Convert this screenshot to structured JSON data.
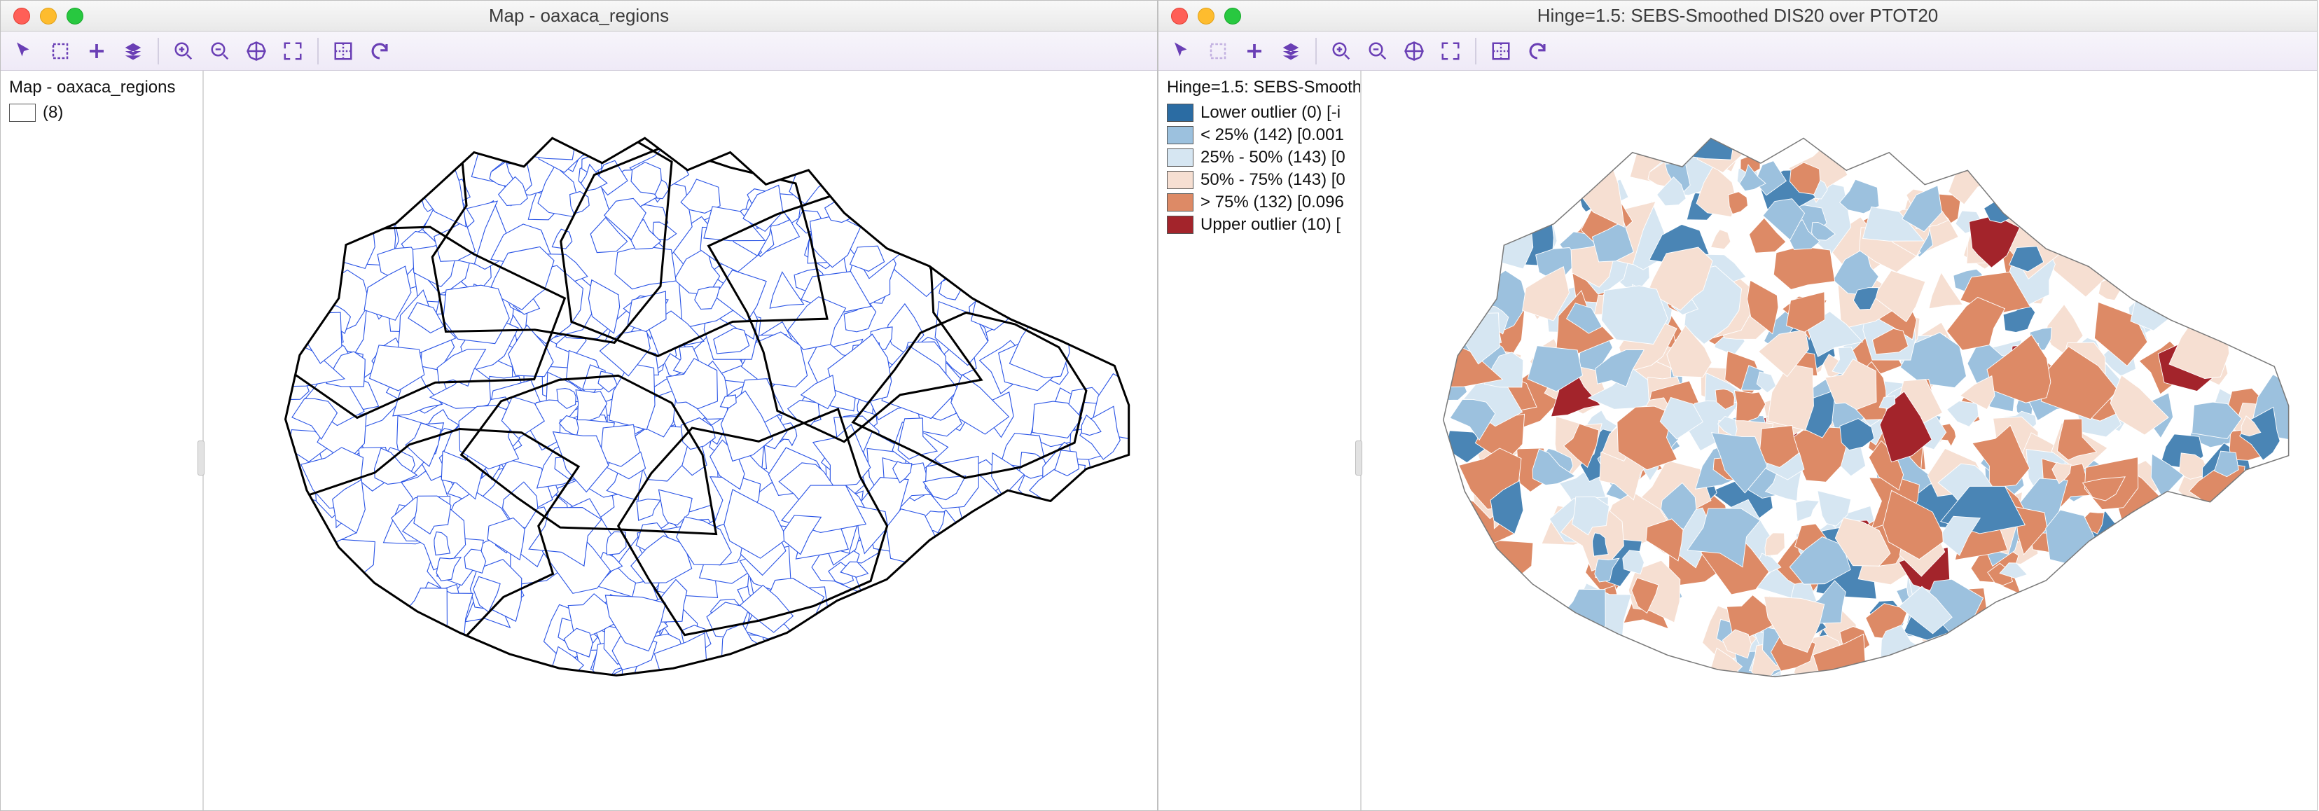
{
  "windows": {
    "left": {
      "title": "Map - oaxaca_regions",
      "legend_title": "Map - oaxaca_regions",
      "legend_items": [
        {
          "fill": "#ffffff",
          "label": "(8)"
        }
      ]
    },
    "right": {
      "title": "Hinge=1.5: SEBS-Smoothed DIS20 over PTOT20",
      "legend_title": "Hinge=1.5: SEBS-Smooth",
      "legend_items": [
        {
          "fill": "#2b6ca3",
          "label": "Lower outlier (0)  [-i"
        },
        {
          "fill": "#9cc1de",
          "label": "< 25% (142)  [0.001"
        },
        {
          "fill": "#d6e6f2",
          "label": "25% - 50% (143)  [0"
        },
        {
          "fill": "#f6dfd2",
          "label": "50% - 75% (143)  [0"
        },
        {
          "fill": "#dd8a66",
          "label": "> 75% (132)  [0.096"
        },
        {
          "fill": "#a3242b",
          "label": "Upper outlier (10)  ["
        }
      ]
    }
  },
  "toolbar_icons": [
    {
      "name": "pointer-icon",
      "disabled": false,
      "svg": "arrow"
    },
    {
      "name": "select-rect-icon",
      "disabled": false,
      "svg": "rect"
    },
    {
      "name": "add-layer-icon",
      "disabled": false,
      "svg": "plus"
    },
    {
      "name": "layers-icon",
      "disabled": false,
      "svg": "layers"
    },
    {
      "name": "sep"
    },
    {
      "name": "zoom-in-icon",
      "disabled": false,
      "svg": "zoomin"
    },
    {
      "name": "zoom-out-icon",
      "disabled": false,
      "svg": "zoomout"
    },
    {
      "name": "pan-icon",
      "disabled": false,
      "svg": "pan"
    },
    {
      "name": "fit-extent-icon",
      "disabled": false,
      "svg": "fit"
    },
    {
      "name": "sep"
    },
    {
      "name": "basemap-icon",
      "disabled": false,
      "svg": "grid"
    },
    {
      "name": "refresh-icon",
      "disabled": false,
      "svg": "refresh"
    }
  ],
  "choropleth_palette": {
    "q1": "#d6e6f2",
    "q2": "#9cc1de",
    "q3": "#4a85b5",
    "q4": "#f6dfd2",
    "q5": "#dd8a66",
    "up": "#a3242b"
  }
}
